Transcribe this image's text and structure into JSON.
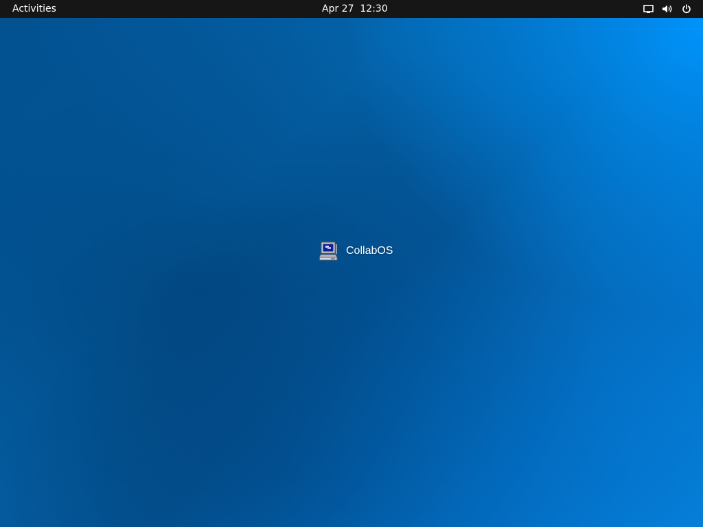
{
  "topbar": {
    "activities_label": "Activities",
    "clock": "Apr 27  12:30",
    "tray_icons": [
      "screen-icon",
      "volume-icon",
      "power-icon"
    ],
    "background_color": "#161616"
  },
  "desktop": {
    "icons": [
      {
        "label": "CollabOS",
        "icon": "computer-icon"
      }
    ],
    "background_colors": [
      "#02508f",
      "#0571c4",
      "#0a8ce6"
    ]
  }
}
